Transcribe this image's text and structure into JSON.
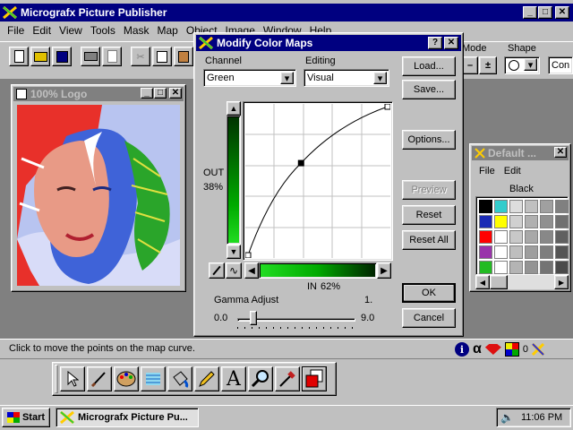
{
  "app": {
    "title": "Micrografx Picture Publisher",
    "menu": [
      "File",
      "Edit",
      "View",
      "Tools",
      "Mask",
      "Map",
      "Object",
      "Image",
      "Window",
      "Help"
    ],
    "mode_label": "Mode",
    "shape_label": "Shape",
    "con_label": "Con",
    "status_text": "Click to move the points on the map curve.",
    "status_right": "0"
  },
  "logo_window": {
    "title": "100% Logo"
  },
  "dialog": {
    "title": "Modify Color Maps",
    "channel_label": "Channel",
    "channel_value": "Green",
    "editing_label": "Editing",
    "editing_value": "Visual",
    "out_label": "OUT",
    "out_value": "38%",
    "in_label": "IN",
    "in_value": "62%",
    "gamma_label": "Gamma Adjust",
    "gamma_value": "1.",
    "gamma_min": "0.0",
    "gamma_max": "9.0",
    "gamma_level": 0.11,
    "buttons": {
      "load": "Load...",
      "save": "Save...",
      "options": "Options...",
      "preview": "Preview",
      "reset": "Reset",
      "reset_all": "Reset All",
      "ok": "OK",
      "cancel": "Cancel"
    },
    "curve_points": [
      [
        0,
        0
      ],
      [
        0.38,
        0.62
      ],
      [
        1,
        1
      ]
    ]
  },
  "palette": {
    "title": "Default ...",
    "menu": [
      "File",
      "Edit"
    ],
    "color_name": "Black",
    "swatches": [
      [
        "#000000",
        "#33cccc",
        "#dddddd",
        "#c0c0c0",
        "#a0a0a0",
        "#808080"
      ],
      [
        "#1b2bb5",
        "#ffff00",
        "#d0d0d0",
        "#b0b0b0",
        "#909090",
        "#707070"
      ],
      [
        "#ff0000",
        "#ffffff",
        "#c8c8c8",
        "#a8a8a8",
        "#888888",
        "#606060"
      ],
      [
        "#9933aa",
        "#ffffff",
        "#bebebe",
        "#9e9e9e",
        "#7e7e7e",
        "#555555"
      ],
      [
        "#22bb22",
        "#ffffff",
        "#b4b4b4",
        "#949494",
        "#747474",
        "#4a4a4a"
      ]
    ]
  },
  "taskbar": {
    "start": "Start",
    "task": "Micrografx Picture Pu...",
    "clock": "11:06 PM"
  },
  "icons": {
    "tools": [
      "arrow-tool-icon",
      "brush-tool-icon",
      "palette-tool-icon",
      "stamp-tool-icon",
      "bucket-tool-icon",
      "pencil-tool-icon",
      "text-tool-icon",
      "zoom-tool-icon",
      "eyedropper-tool-icon",
      "color-swatch-icon"
    ]
  }
}
